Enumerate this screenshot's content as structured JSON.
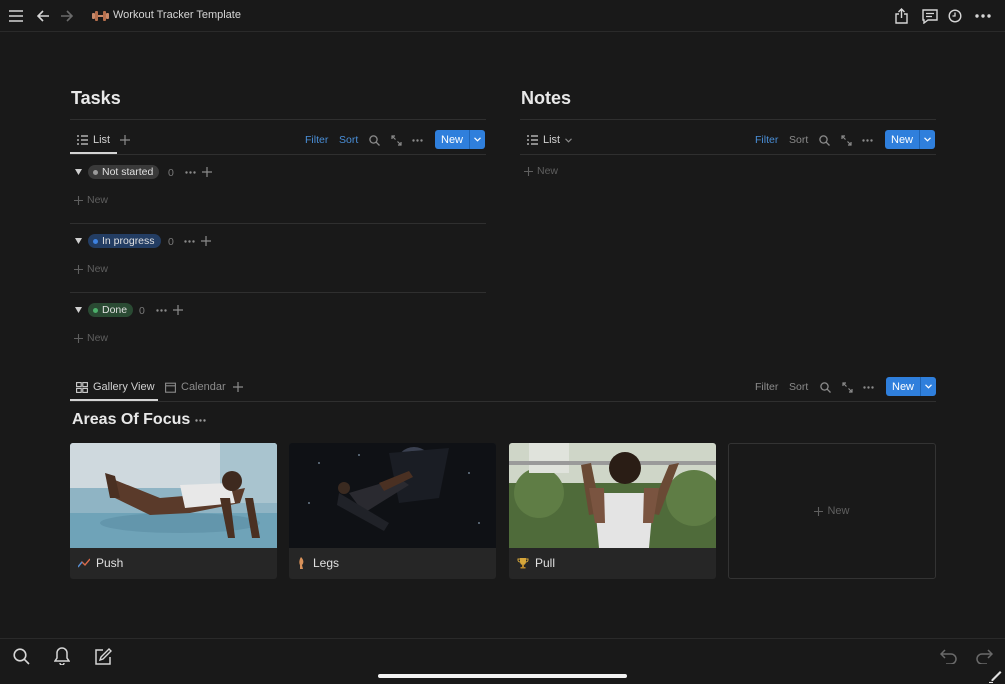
{
  "topbar": {
    "title": "Workout Tracker Template"
  },
  "tasks": {
    "title": "Tasks",
    "view_tab": "List",
    "filter": "Filter",
    "sort": "Sort",
    "new_label": "New",
    "groups": [
      {
        "label": "Not started",
        "count": "0",
        "new": "New",
        "color": "#9b9b9b",
        "bg": "#3a3a3a"
      },
      {
        "label": "In progress",
        "count": "0",
        "new": "New",
        "color": "#3e82e0",
        "bg": "#233d63"
      },
      {
        "label": "Done",
        "count": "0",
        "new": "New",
        "color": "#4caf6a",
        "bg": "#2a4a33"
      }
    ]
  },
  "notes": {
    "title": "Notes",
    "view_tab": "List",
    "filter": "Filter",
    "sort": "Sort",
    "new_label": "New",
    "empty_new": "New"
  },
  "gallery": {
    "tabs": [
      "Gallery View",
      "Calendar"
    ],
    "filter": "Filter",
    "sort": "Sort",
    "new_label": "New",
    "title": "Areas Of Focus",
    "cards": [
      {
        "label": "Push",
        "icon": "chart-line-icon"
      },
      {
        "label": "Legs",
        "icon": "leg-icon"
      },
      {
        "label": "Pull",
        "icon": "trophy-icon"
      }
    ],
    "add_new": "New"
  },
  "colors": {
    "accent": "#2f7fdc",
    "background": "#191919"
  }
}
